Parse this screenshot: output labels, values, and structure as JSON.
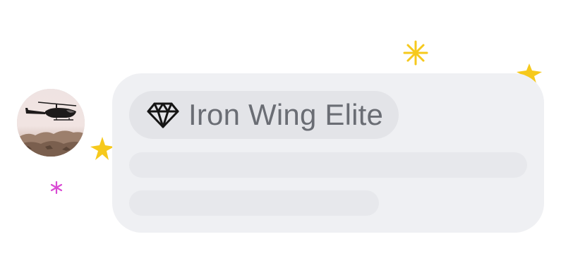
{
  "avatar": {
    "icon": "helicopter-photo"
  },
  "badge": {
    "icon": "diamond-icon",
    "label": "Iron Wing Elite"
  },
  "placeholders": {
    "line_count": 2
  },
  "decorations": {
    "colors": {
      "yellow": "#f6c91c",
      "magenta": "#d94bd4"
    }
  },
  "colors": {
    "bubble_bg": "#eff0f3",
    "chip_bg": "#e3e4e8",
    "chip_text": "#6a6d74",
    "skeleton": "#e7e8ec"
  }
}
